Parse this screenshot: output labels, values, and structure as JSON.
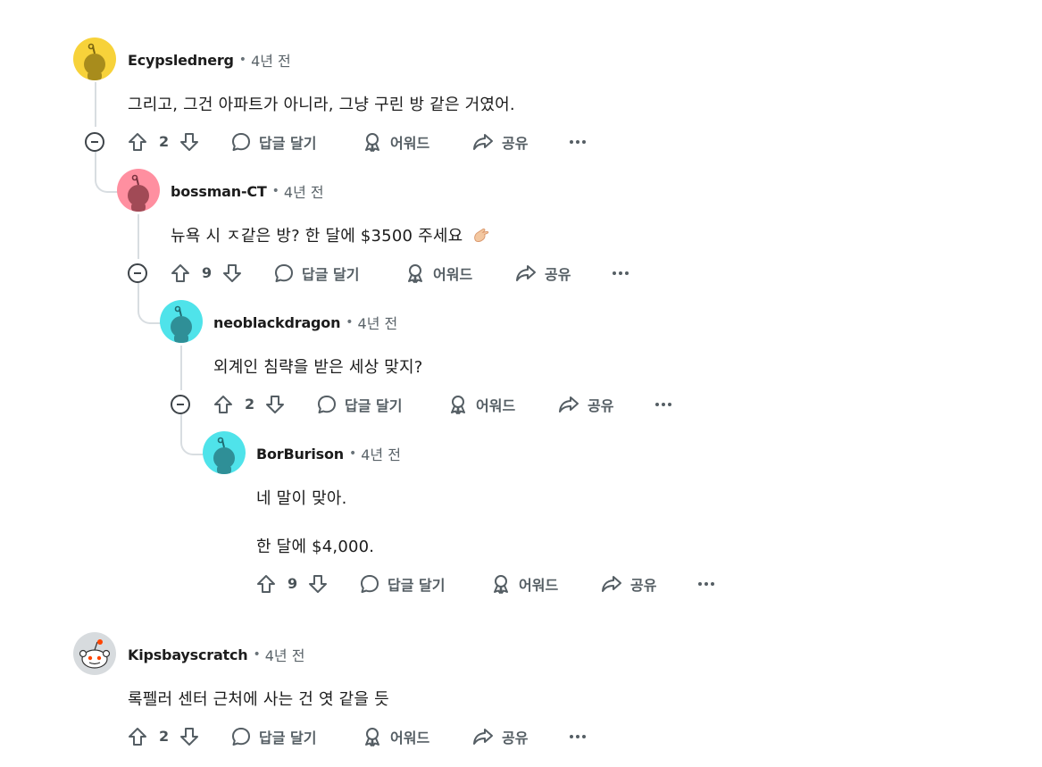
{
  "colors": {
    "thread_line": "#d8dde1",
    "action_text": "#555e64",
    "meta_text": "#5a6369"
  },
  "actions": {
    "reply": "답글 달기",
    "award": "어워드",
    "share": "공유",
    "more_icon": "more-horizontal-icon"
  },
  "comments": [
    {
      "author": "Ecypslednerg",
      "time": "4년 전",
      "avatar_color": "#f7d23a",
      "lines": [
        "그리고, 그건 아파트가 아니라, 그냥 구린 방 같은 거였어."
      ],
      "votes": "2"
    },
    {
      "author": "bossman-CT",
      "time": "4년 전",
      "avatar_color": "#ff8fa0",
      "lines": [
        "뉴욕 시 ㅈ같은 방? 한 달에 $3500 주세요"
      ],
      "emoji": "pinching-hand-emoji",
      "votes": "9"
    },
    {
      "author": "neoblackdragon",
      "time": "4년 전",
      "avatar_color": "#4fe3ea",
      "lines": [
        "외계인 침략을 받은 세상 맞지?"
      ],
      "votes": "2"
    },
    {
      "author": "BorBurison",
      "time": "4년 전",
      "avatar_color": "#4fe3ea",
      "lines": [
        "네 말이 맞아.",
        "한 달에 $4,000."
      ],
      "votes": "9"
    },
    {
      "author": "Kipsbayscratch",
      "time": "4년 전",
      "avatar_color": "#d7dbde",
      "lines": [
        "록펠러 센터 근처에 사는 건 엿 같을 듯"
      ],
      "votes": "2"
    }
  ]
}
